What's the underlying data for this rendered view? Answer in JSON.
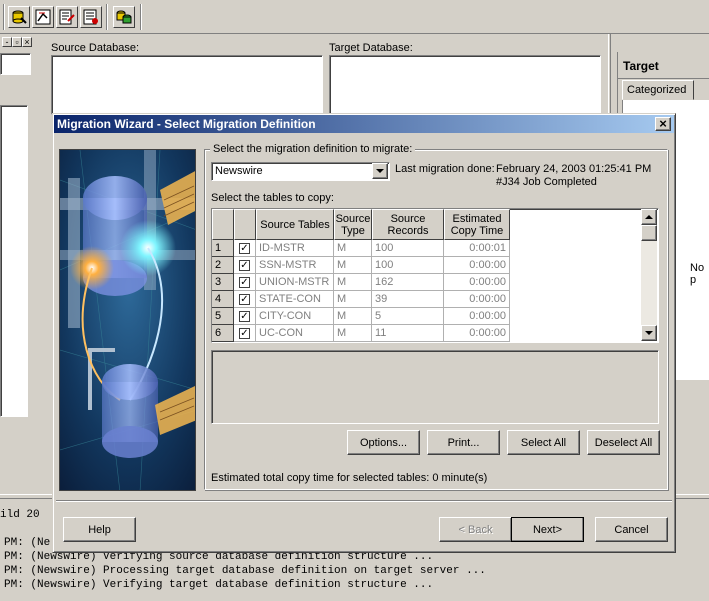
{
  "toolbar": {
    "icons": [
      "db-wizard-icon",
      "db-connect-icon",
      "db-edit-icon",
      "db-properties-icon",
      "db-migrate-icon"
    ]
  },
  "background": {
    "source_db_label": "Source Database:",
    "target_db_label": "Target Database:",
    "right_panel_title": "Target",
    "right_tab": "Categorized",
    "right_fragment": "No p",
    "left_fragment": "ild 20"
  },
  "log_lines": [
    "PM: (Ne",
    "PM: (Newswire) Verifying source database definition structure ...",
    "PM: (Newswire) Processing target database definition on target server ...",
    "PM: (Newswire) Verifying target database definition structure ..."
  ],
  "dialog": {
    "title": "Migration Wizard - Select Migration Definition",
    "close": "×",
    "select_def_label": "Select the migration definition to migrate:",
    "definition_value": "Newswire",
    "last_migration_label": "Last migration done:",
    "last_migration_date": "February 24, 2003 01:25:41 PM",
    "last_migration_status": "#J34 Job Completed",
    "select_tables_label": "Select the tables to copy:",
    "columns": {
      "source_tables": "Source Tables",
      "source_type_1": "Source",
      "source_type_2": "Type",
      "source_records_1": "Source",
      "source_records_2": "Records",
      "copy_time_1": "Estimated",
      "copy_time_2": "Copy Time"
    },
    "rows": [
      {
        "num": "1",
        "checked": "✓",
        "table": "ID-MSTR",
        "type": "M",
        "records": "100",
        "time": "0:00:01"
      },
      {
        "num": "2",
        "checked": "✓",
        "table": "SSN-MSTR",
        "type": "M",
        "records": "100",
        "time": "0:00:00"
      },
      {
        "num": "3",
        "checked": "✓",
        "table": "UNION-MSTR",
        "type": "M",
        "records": "162",
        "time": "0:00:00"
      },
      {
        "num": "4",
        "checked": "✓",
        "table": "STATE-CON",
        "type": "M",
        "records": "39",
        "time": "0:00:00"
      },
      {
        "num": "5",
        "checked": "✓",
        "table": "CITY-CON",
        "type": "M",
        "records": "5",
        "time": "0:00:00"
      },
      {
        "num": "6",
        "checked": "✓",
        "table": "UC-CON",
        "type": "M",
        "records": "11",
        "time": "0:00:00"
      }
    ],
    "buttons": {
      "options": "Options...",
      "print": "Print...",
      "select_all": "Select All",
      "deselect_all": "Deselect All",
      "help": "Help",
      "back": "< Back",
      "next": "Next>",
      "cancel": "Cancel"
    },
    "estimated_total": "Estimated total copy time for selected tables: 0 minute(s)"
  }
}
